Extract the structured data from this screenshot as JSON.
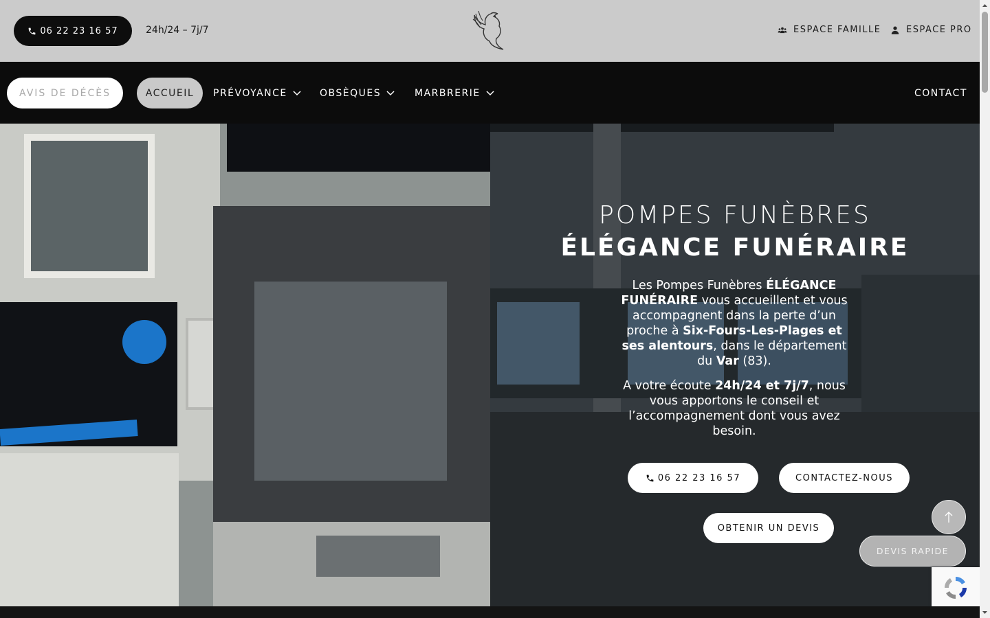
{
  "topbar": {
    "phone": "06 22 23 16 57",
    "hours": "24h/24 – 7j/7",
    "espace_famille": "ESPACE FAMILLE",
    "espace_pro": "ESPACE PRO"
  },
  "nav": {
    "avis": "AVIS DE DÉCÈS",
    "accueil": "ACCUEIL",
    "prevoyance": "PRÉVOYANCE",
    "obseques": "OBSÈQUES",
    "marbrerie": "MARBRERIE",
    "contact": "CONTACT"
  },
  "hero": {
    "title_line1": "POMPES FUNÈBRES",
    "title_line2": "ÉLÉGANCE FUNÉRAIRE",
    "p1": {
      "t1": "Les Pompes Funèbres ",
      "b1": "ÉLÉGANCE FUNÉRAIRE",
      "t2": " vous accueillent et vous accompagnent dans la perte d’un proche à ",
      "b2": "Six-Fours-Les-Plages et ses alentours",
      "t3": ", dans le département du ",
      "b3": "Var",
      "t4": " (83)."
    },
    "p2": {
      "t1": "A votre écoute ",
      "b1": "24h/24 et 7j/7",
      "t2": ", nous vous apportons le conseil et l’accompagnement dont vous avez besoin."
    },
    "cta_phone": "06 22 23 16 57",
    "cta_contact": "CONTACTEZ-NOUS",
    "cta_devis": "OBTENIR UN DEVIS"
  },
  "floating": {
    "devis_rapide": "DEVIS RAPIDE"
  },
  "colors": {
    "topbar_bg": "#cbcbcb",
    "nav_bg": "#0c0c0c",
    "accent_light": "#c9c9c9"
  }
}
